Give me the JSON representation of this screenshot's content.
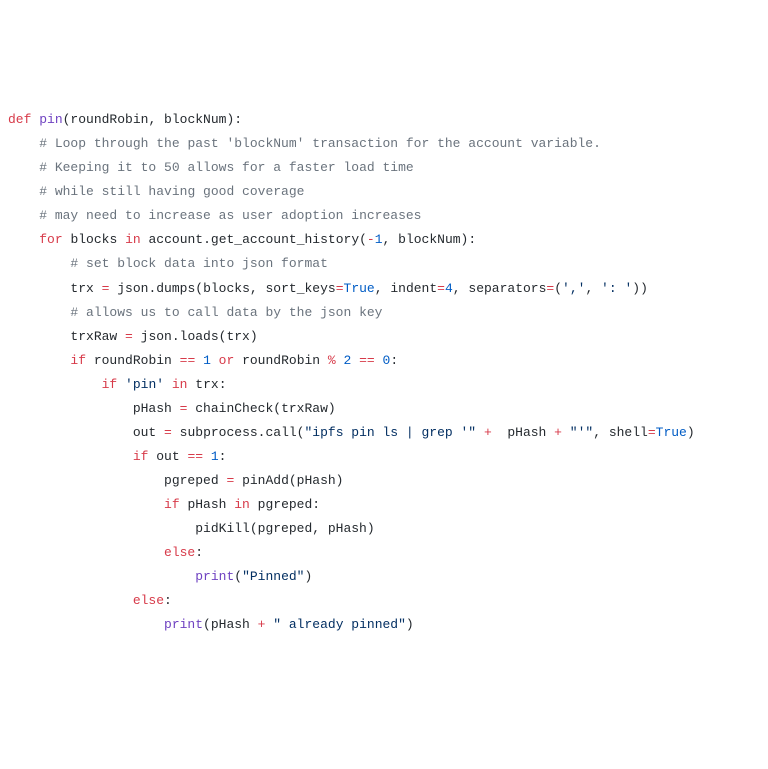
{
  "code": {
    "l1": {
      "def": "def",
      "name": "pin",
      "args": "(roundRobin, blockNum):"
    },
    "l2": {
      "c": "# Loop through the past 'blockNum' transaction for the account variable."
    },
    "l3": {
      "c": "# Keeping it to 50 allows for a faster load time"
    },
    "l4": {
      "c": "# while still having good coverage"
    },
    "l5": {
      "c": "# may need to increase as user adoption increases"
    },
    "l6": {
      "for": "for",
      "v": "blocks",
      "in": "in",
      "call": "account.get_account_history(",
      "n1": "-",
      "n1b": "1",
      "sep": ", blockNum):"
    },
    "l7": {
      "c": "# set block data into json format"
    },
    "l8": {
      "lhs": "trx ",
      "eq": "=",
      "mid": " json.dumps(blocks, ",
      "k1": "sort_keys",
      "eq2": "=",
      "v1": "True",
      "s2": ", ",
      "k2": "indent",
      "eq3": "=",
      "v2": "4",
      "s3": ", ",
      "k3": "separators",
      "eq4": "=",
      "p1": "(",
      "str1": "','",
      "cm": ", ",
      "str2": "': '",
      "p2": "))"
    },
    "l9": {
      "c": "# allows us to call data by the json key"
    },
    "l10": {
      "lhs": "trxRaw ",
      "eq": "=",
      "rhs": " json.loads(trx)"
    },
    "l11": {
      "if": "if",
      "a": " roundRobin ",
      "op1": "==",
      "n1": " 1 ",
      "or": "or",
      "b": " roundRobin ",
      "op2": "%",
      "n2": " 2 ",
      "op3": "==",
      "n3": " 0",
      "end": ":"
    },
    "l12": {
      "if": "if",
      "sp": " ",
      "str": "'pin'",
      "sp2": " ",
      "in": "in",
      "rhs": " trx:"
    },
    "l13": {
      "lhs": "pHash ",
      "eq": "=",
      "rhs": " chainCheck(trxRaw)"
    },
    "l14": {
      "lhs": "out ",
      "eq": "=",
      "mid": " subprocess.call(",
      "str1": "\"ipfs pin ls | grep '\"",
      "sp": " ",
      "plus": "+",
      "sp2": "  pHash ",
      "plus2": "+",
      "sp3": " ",
      "str2": "\"'\"",
      "cm": ", ",
      "kw": "shell",
      "eq2": "=",
      "val": "True",
      "end": ")"
    },
    "l15": {
      "if": "if",
      "a": " out ",
      "op": "==",
      "n": " 1",
      "end": ":"
    },
    "l16": {
      "lhs": "pgreped ",
      "eq": "=",
      "rhs": " pinAdd(pHash)"
    },
    "l17": {
      "if": "if",
      "a": " pHash ",
      "in": "in",
      "b": " pgreped:"
    },
    "l18": {
      "call": "pidKill(pgreped, pHash)"
    },
    "l19": {
      "else": "else",
      "end": ":"
    },
    "l20": {
      "pr": "print",
      "p1": "(",
      "str": "\"Pinned\"",
      "p2": ")"
    },
    "l21": {
      "else": "else",
      "end": ":"
    },
    "l22": {
      "pr": "print",
      "p1": "(pHash ",
      "plus": "+",
      "sp": " ",
      "str": "\" already pinned\"",
      "p2": ")"
    }
  }
}
